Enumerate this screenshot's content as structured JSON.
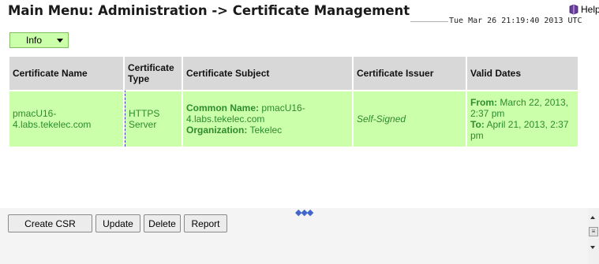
{
  "header": {
    "title": "Main Menu: Administration -> Certificate Management",
    "help_label": "Help",
    "timestamp": "Tue Mar 26 21:19:40 2013 UTC"
  },
  "info_menu": {
    "label": "Info"
  },
  "table": {
    "columns": [
      "Certificate Name",
      "Certificate Type",
      "Certificate Subject",
      "Certificate Issuer",
      "Valid Dates"
    ],
    "row": {
      "name": "pmacU16-4.labs.tekelec.com",
      "type": "HTTPS Server",
      "subject_cn_label": "Common Name:",
      "subject_cn_value": "pmacU16-4.labs.tekelec.com",
      "subject_org_label": "Organization:",
      "subject_org_value": "Tekelec",
      "issuer": "Self-Signed",
      "from_label": "From:",
      "from_value": "March 22, 2013, 2:37 pm",
      "to_label": "To:",
      "to_value": "April 21, 2013, 2:37 pm"
    }
  },
  "buttons": {
    "create_csr": "Create CSR",
    "update": "Update",
    "delete": "Delete",
    "report": "Report"
  },
  "colors": {
    "row_bg": "#ccffaa",
    "row_text": "#2e8b2e",
    "header_bg": "#d8d8d8"
  },
  "icons": {
    "help": "help-book-icon",
    "splitter": "resize-handle-icon"
  }
}
